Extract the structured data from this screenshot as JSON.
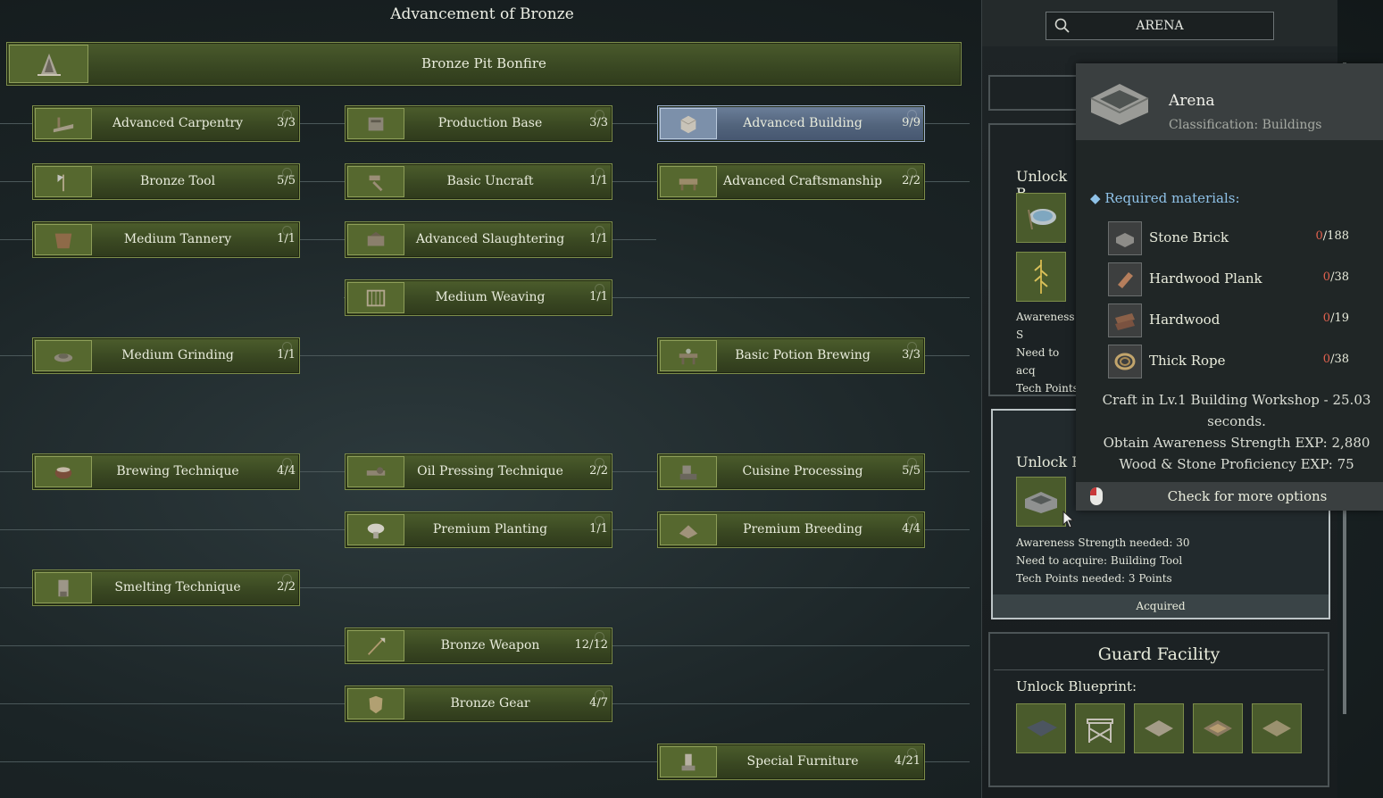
{
  "title": "Advancement of Bronze",
  "bonfire": {
    "label": "Bronze Pit Bonfire",
    "icon": "bonfire-icon"
  },
  "nodes": [
    {
      "label": "Advanced Carpentry",
      "count": "3/3",
      "icon": "carpentry-icon"
    },
    {
      "label": "Production Base",
      "count": "3/3",
      "icon": "production-icon"
    },
    {
      "label": "Advanced Building",
      "count": "9/9",
      "icon": "building-block-icon",
      "selected": true
    },
    {
      "label": "Bronze Tool",
      "count": "5/5",
      "icon": "axe-icon"
    },
    {
      "label": "Basic Uncraft",
      "count": "1/1",
      "icon": "uncraft-icon"
    },
    {
      "label": "Advanced Craftsmanship",
      "count": "2/2",
      "icon": "workbench-icon"
    },
    {
      "label": "Medium Tannery",
      "count": "1/1",
      "icon": "tannery-icon"
    },
    {
      "label": "Advanced Slaughtering",
      "count": "1/1",
      "icon": "slaughter-icon"
    },
    {
      "label": "Medium Weaving",
      "count": "1/1",
      "icon": "loom-icon"
    },
    {
      "label": "Medium Grinding",
      "count": "1/1",
      "icon": "grinding-icon"
    },
    {
      "label": "Basic Potion Brewing",
      "count": "3/3",
      "icon": "potion-icon"
    },
    {
      "label": "Brewing Technique",
      "count": "4/4",
      "icon": "brewing-icon"
    },
    {
      "label": "Oil Pressing Technique",
      "count": "2/2",
      "icon": "oil-press-icon"
    },
    {
      "label": "Cuisine Processing",
      "count": "5/5",
      "icon": "cuisine-icon"
    },
    {
      "label": "Premium Planting",
      "count": "1/1",
      "icon": "planting-icon"
    },
    {
      "label": "Premium Breeding",
      "count": "4/4",
      "icon": "breeding-icon"
    },
    {
      "label": "Smelting Technique",
      "count": "2/2",
      "icon": "smelting-icon"
    },
    {
      "label": "Bronze Weapon",
      "count": "12/12",
      "icon": "spear-icon"
    },
    {
      "label": "Bronze Gear",
      "count": "4/7",
      "icon": "armor-icon"
    },
    {
      "label": "Special Furniture",
      "count": "4/21",
      "icon": "furniture-icon"
    }
  ],
  "search": {
    "value": "ARENA"
  },
  "cards": {
    "first": {
      "head": "Unlock B",
      "lines": [
        "Awareness S",
        "Need to acq",
        "Tech Points"
      ]
    },
    "second": {
      "head": "Unlock B",
      "lines": [
        "Awareness Strength needed: 30",
        "Need to acquire: Building Tool",
        "Tech Points needed: 3 Points"
      ],
      "status": "Acquired"
    },
    "guard": {
      "title": "Guard Facility",
      "subtitle": "Unlock Blueprint:"
    }
  },
  "tooltip": {
    "name": "Arena",
    "classification": "Classification: Buildings",
    "required_label": "Required materials:",
    "materials": [
      {
        "name": "Stone Brick",
        "have": "0",
        "need": "/188",
        "icon": "stone-brick-icon"
      },
      {
        "name": "Hardwood Plank",
        "have": "0",
        "need": "/38",
        "icon": "plank-icon"
      },
      {
        "name": "Hardwood",
        "have": "0",
        "need": "/19",
        "icon": "log-icon"
      },
      {
        "name": "Thick Rope",
        "have": "0",
        "need": "/38",
        "icon": "rope-icon"
      }
    ],
    "craft_line1": "Craft in Lv.1 Building Workshop - 25.03",
    "craft_line2": "seconds.",
    "exp_line1": "Obtain Awareness Strength EXP: 2,880",
    "exp_line2": "Wood & Stone Proficiency EXP: 75",
    "footer": "Check for more options"
  },
  "colors": {
    "node_green": "#3a4822",
    "node_border": "#7d8d4a",
    "selected_blue": "#52647c",
    "material_missing": "#e0614e",
    "accent_blue": "#8fc2e8"
  }
}
